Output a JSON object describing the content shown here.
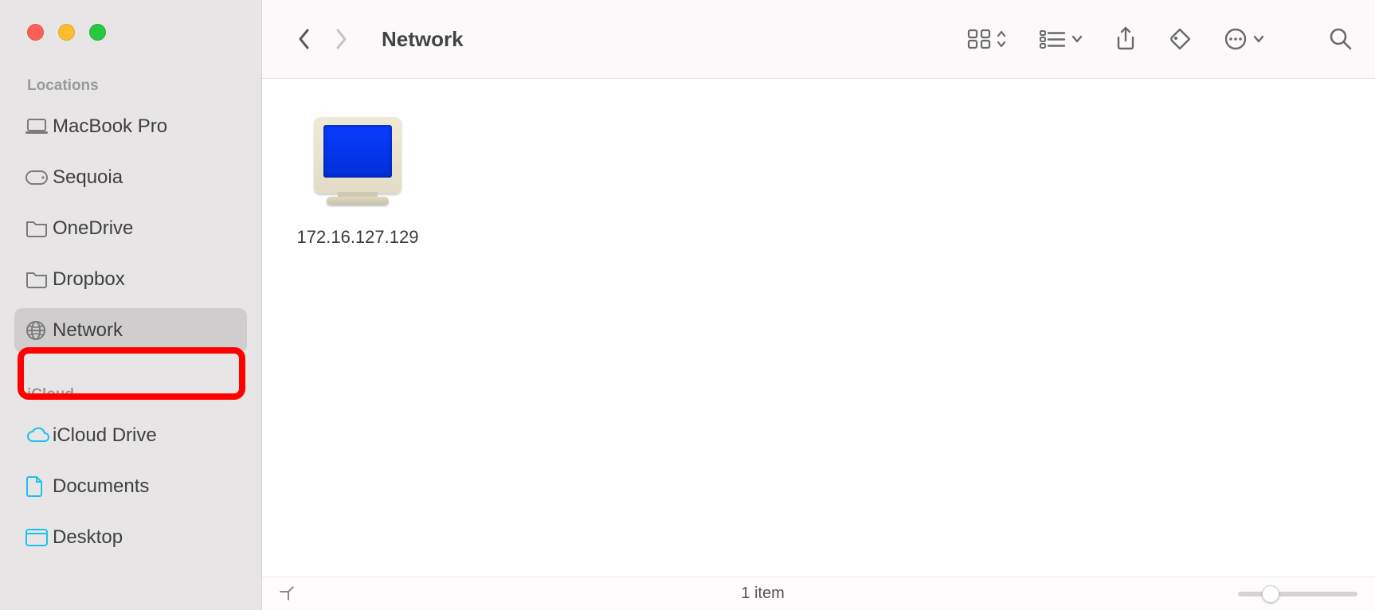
{
  "window_title": "Network",
  "sidebar": {
    "sections": [
      {
        "label": "Locations",
        "items": [
          {
            "icon": "laptop",
            "label": "MacBook Pro",
            "selected": false
          },
          {
            "icon": "disk",
            "label": "Sequoia",
            "selected": false
          },
          {
            "icon": "folder",
            "label": "OneDrive",
            "selected": false
          },
          {
            "icon": "folder",
            "label": "Dropbox",
            "selected": false
          },
          {
            "icon": "globe",
            "label": "Network",
            "selected": true,
            "highlighted_annotation": true
          }
        ]
      },
      {
        "label": "iCloud",
        "items": [
          {
            "icon": "cloud",
            "label": "iCloud Drive",
            "selected": false
          },
          {
            "icon": "doc",
            "label": "Documents",
            "selected": false
          },
          {
            "icon": "desktop",
            "label": "Desktop",
            "selected": false
          }
        ]
      }
    ]
  },
  "content_items": [
    {
      "type": "network-computer",
      "label": "172.16.127.129"
    }
  ],
  "statusbar": {
    "item_count_text": "1 item"
  }
}
